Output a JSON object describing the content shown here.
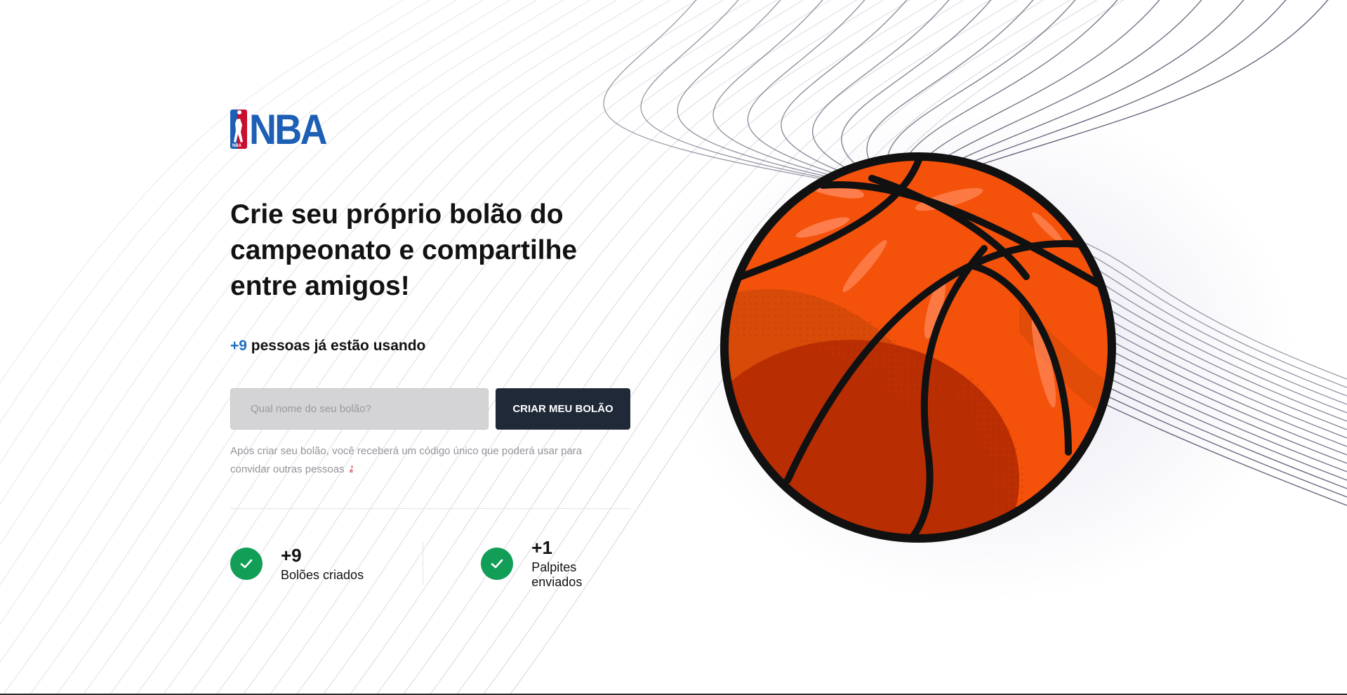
{
  "brand": {
    "logo_text": "NBA",
    "primary": "#1d5fb4",
    "accent": "#c8102e"
  },
  "hero": {
    "headline": "Crie seu próprio bolão do campeonato e compartilhe entre amigos!",
    "users_count": "+9",
    "users_text": " pessoas já estão usando"
  },
  "form": {
    "pool_name_placeholder": "Qual nome do seu bolão?",
    "pool_name_value": "",
    "create_button_label": "CRIAR MEU BOLÃO"
  },
  "help_text": "Após criar seu bolão, você receberá um código único que poderá usar para convidar outras pessoas",
  "stats": [
    {
      "value": "+9",
      "label": "Bolões criados",
      "icon": "check-icon"
    },
    {
      "value": "+1",
      "label": "Palpites enviados",
      "icon": "check-icon"
    }
  ],
  "colors": {
    "button_bg": "#1f2937",
    "check_green": "#129e57",
    "ball_orange": "#f4510b"
  }
}
